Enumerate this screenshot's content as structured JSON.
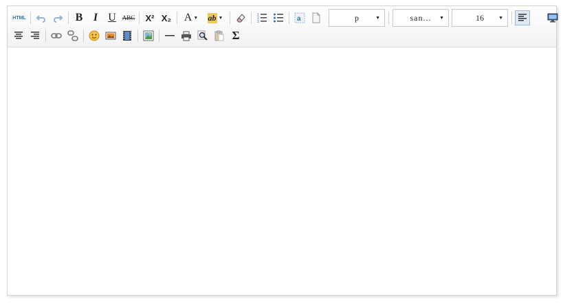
{
  "toolbar": {
    "html_label": "HTML",
    "bold_label": "B",
    "italic_label": "I",
    "underline_label": "U",
    "strike_label": "ABC",
    "superscript_label": "X²",
    "subscript_label": "X₂",
    "font_color_label": "A",
    "highlight_label": "ab",
    "formula_label": "Σ",
    "paragraph": {
      "value": "p"
    },
    "font_family": {
      "value": "san..."
    },
    "font_size": {
      "value": "16"
    }
  },
  "icons": {
    "html": "source-code-icon",
    "undo": "undo-icon",
    "redo": "redo-icon",
    "eraser": "eraser-icon",
    "ordered_list": "ordered-list-icon",
    "unordered_list": "unordered-list-icon",
    "anchor": "anchor-icon",
    "page": "blank-page-icon",
    "align_left": "align-left-icon",
    "preview": "monitor-icon",
    "align_center": "align-center-icon",
    "align_right": "align-right-icon",
    "link": "link-icon",
    "unlink": "unlink-icon",
    "emotion": "emoticon-icon",
    "image": "image-icon",
    "video": "video-icon",
    "gallery": "gallery-icon",
    "horizontal_rule": "horizontal-rule-icon",
    "print": "print-icon",
    "search": "search-icon",
    "paste": "paste-icon",
    "formula": "sigma-icon"
  },
  "colors": {
    "accent": "#2d6fb6",
    "toolbar_bg": "#f2f2f2",
    "border": "#d4d4d4",
    "active_bg": "#dde8f3"
  },
  "editor": {
    "content": ""
  }
}
